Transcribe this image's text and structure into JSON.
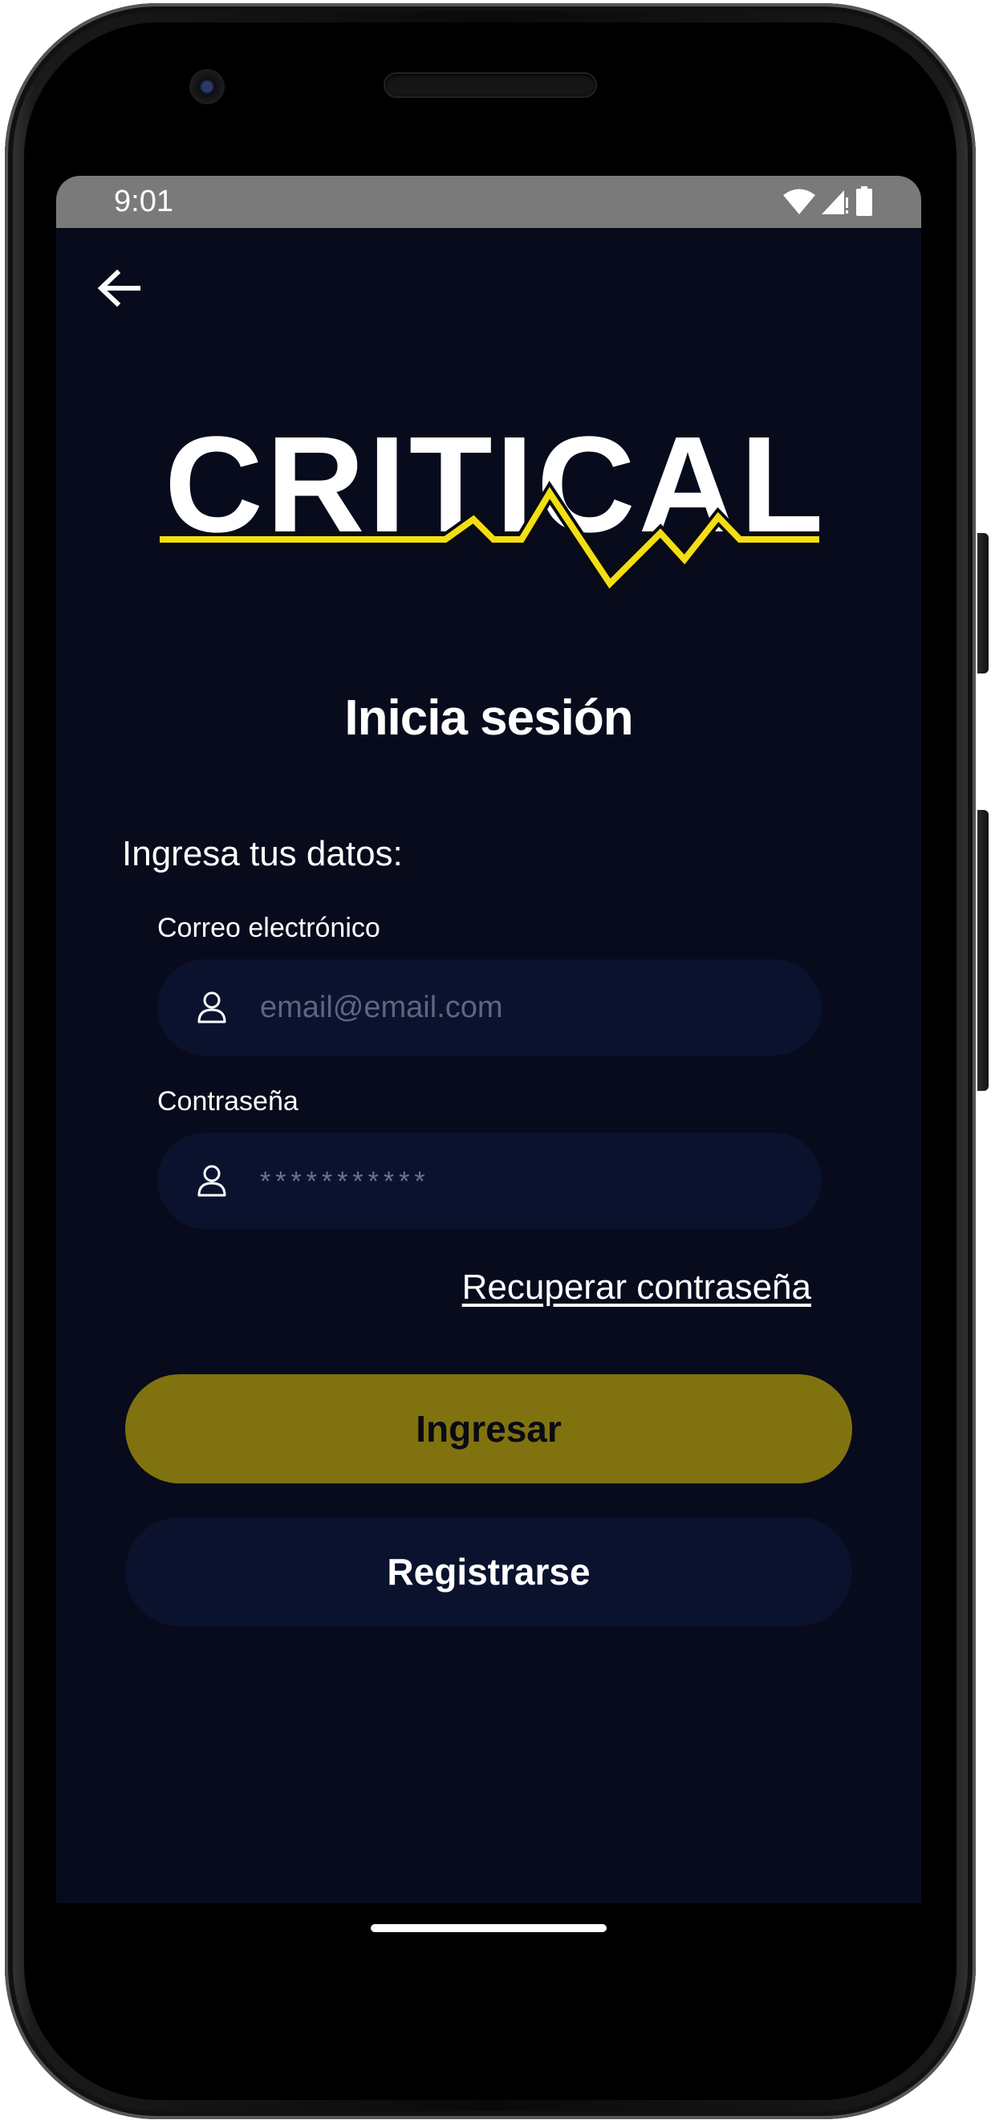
{
  "status_bar": {
    "time": "9:01",
    "icons": [
      "wifi-icon",
      "signal-icon",
      "battery-icon"
    ]
  },
  "nav": {
    "back_icon": "arrow-left-icon"
  },
  "logo": {
    "text": "CRITICAL",
    "accent_color": "#f2de13"
  },
  "page": {
    "title": "Inicia sesión",
    "subtitle": "Ingresa tus datos:"
  },
  "form": {
    "email": {
      "label": "Correo electrónico",
      "placeholder": "email@email.com",
      "value": "",
      "icon": "user-icon"
    },
    "password": {
      "label": "Contraseña",
      "placeholder": "***********",
      "value": "",
      "icon": "user-icon"
    },
    "recover_link": "Recuperar contraseña"
  },
  "actions": {
    "login_label": "Ingresar",
    "register_label": "Registrarse"
  },
  "colors": {
    "background": "#070b1c",
    "field_bg": "#0b122e",
    "primary_button": "#80730f",
    "status_bar": "#7a7a7a"
  }
}
